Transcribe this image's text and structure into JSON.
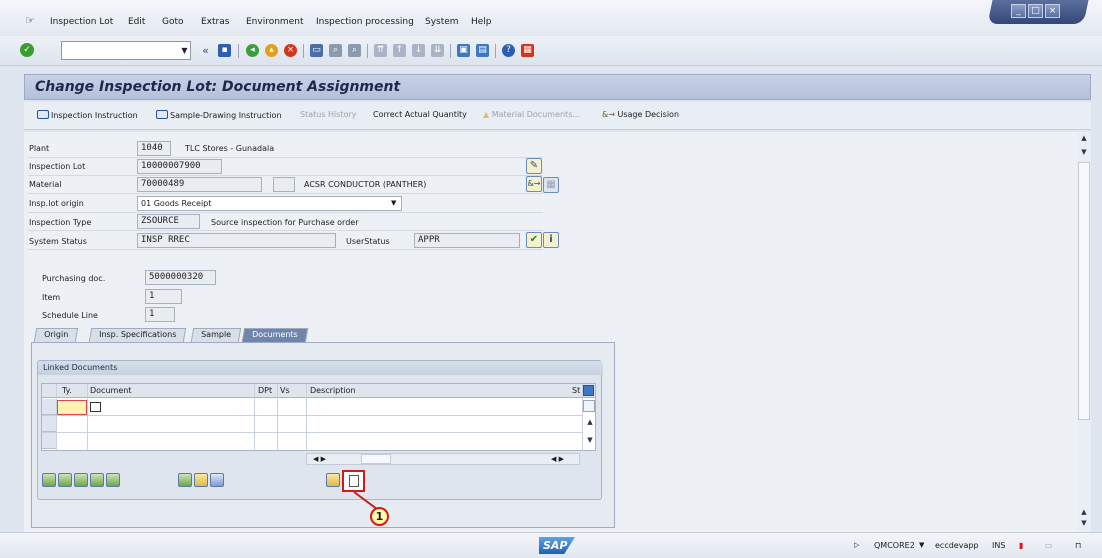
{
  "menu": {
    "items": [
      "Inspection Lot",
      "Edit",
      "Goto",
      "Extras",
      "Environment",
      "Inspection processing",
      "System",
      "Help"
    ]
  },
  "toolbar": {
    "command_field_value": ""
  },
  "title": "Change Inspection Lot: Document Assignment",
  "app_toolbar": {
    "inspection_instruction": "Inspection Instruction",
    "sample_drawing_instruction": "Sample-Drawing Instruction",
    "status_history": "Status History",
    "correct_actual_quantity": "Correct Actual Quantity",
    "material_documents": "Material Documents...",
    "usage_decision": "Usage Decision"
  },
  "header": {
    "plant_label": "Plant",
    "plant_value": "1040",
    "plant_desc": "TLC Stores - Gunadala",
    "lot_label": "Inspection Lot",
    "lot_value": "10000007900",
    "material_label": "Material",
    "material_value": "70000489",
    "material_desc": "ACSR CONDUCTOR (PANTHER)",
    "origin_label": "Insp.lot origin",
    "origin_value": "01 Goods Receipt",
    "type_label": "Inspection Type",
    "type_value": "ZSOURCE",
    "type_desc": "Source inspection for Purchase order",
    "status_label": "System Status",
    "status_value": "INSP RREC",
    "userstatus_label": "UserStatus",
    "userstatus_value": "APPR"
  },
  "purchase": {
    "doc_label": "Purchasing doc.",
    "doc_value": "5000000320",
    "item_label": "Item",
    "item_value": "1",
    "schedule_label": "Schedule Line",
    "schedule_value": "1"
  },
  "tabs": [
    {
      "label": "Origin"
    },
    {
      "label": "Insp. Specifications"
    },
    {
      "label": "Sample"
    },
    {
      "label": "Documents"
    }
  ],
  "linked_documents": {
    "title": "Linked Documents",
    "columns": {
      "type": "Ty.",
      "document": "Document",
      "dpt": "DPt",
      "vs": "Vs",
      "description": "Description",
      "st": "St"
    }
  },
  "callout_number": "1",
  "status_bar": {
    "logo": "SAP",
    "system": "QMCORE2",
    "server": "eccdevapp",
    "mode": "INS"
  }
}
